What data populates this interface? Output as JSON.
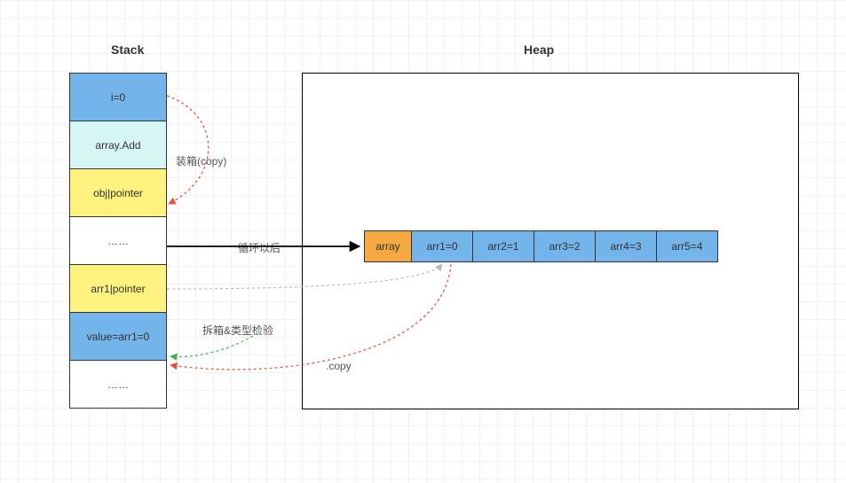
{
  "titles": {
    "stack": "Stack",
    "heap": "Heap"
  },
  "stack": {
    "cells": [
      {
        "label": "i=0",
        "color": "c-blue"
      },
      {
        "label": "array.Add",
        "color": "c-cyan"
      },
      {
        "label": "obj|pointer",
        "color": "c-yellow"
      },
      {
        "label": "……",
        "color": "c-white"
      },
      {
        "label": "arr1|pointer",
        "color": "c-yellow"
      },
      {
        "label": "value=arr1=0",
        "color": "c-blue"
      },
      {
        "label": "……",
        "color": "c-white"
      }
    ]
  },
  "heap": {
    "array_cells": [
      {
        "label": "array",
        "color": "c-orange"
      },
      {
        "label": "arr1=0",
        "color": "c-blue"
      },
      {
        "label": "arr2=1",
        "color": "c-blue"
      },
      {
        "label": "arr3=2",
        "color": "c-blue"
      },
      {
        "label": "arr4=3",
        "color": "c-blue"
      },
      {
        "label": "arr5=4",
        "color": "c-blue"
      }
    ]
  },
  "annotations": {
    "boxing": "装箱(copy)",
    "after_loop": "循环以后",
    "unboxing": "拆箱&类型检验",
    "copy": ".copy"
  }
}
